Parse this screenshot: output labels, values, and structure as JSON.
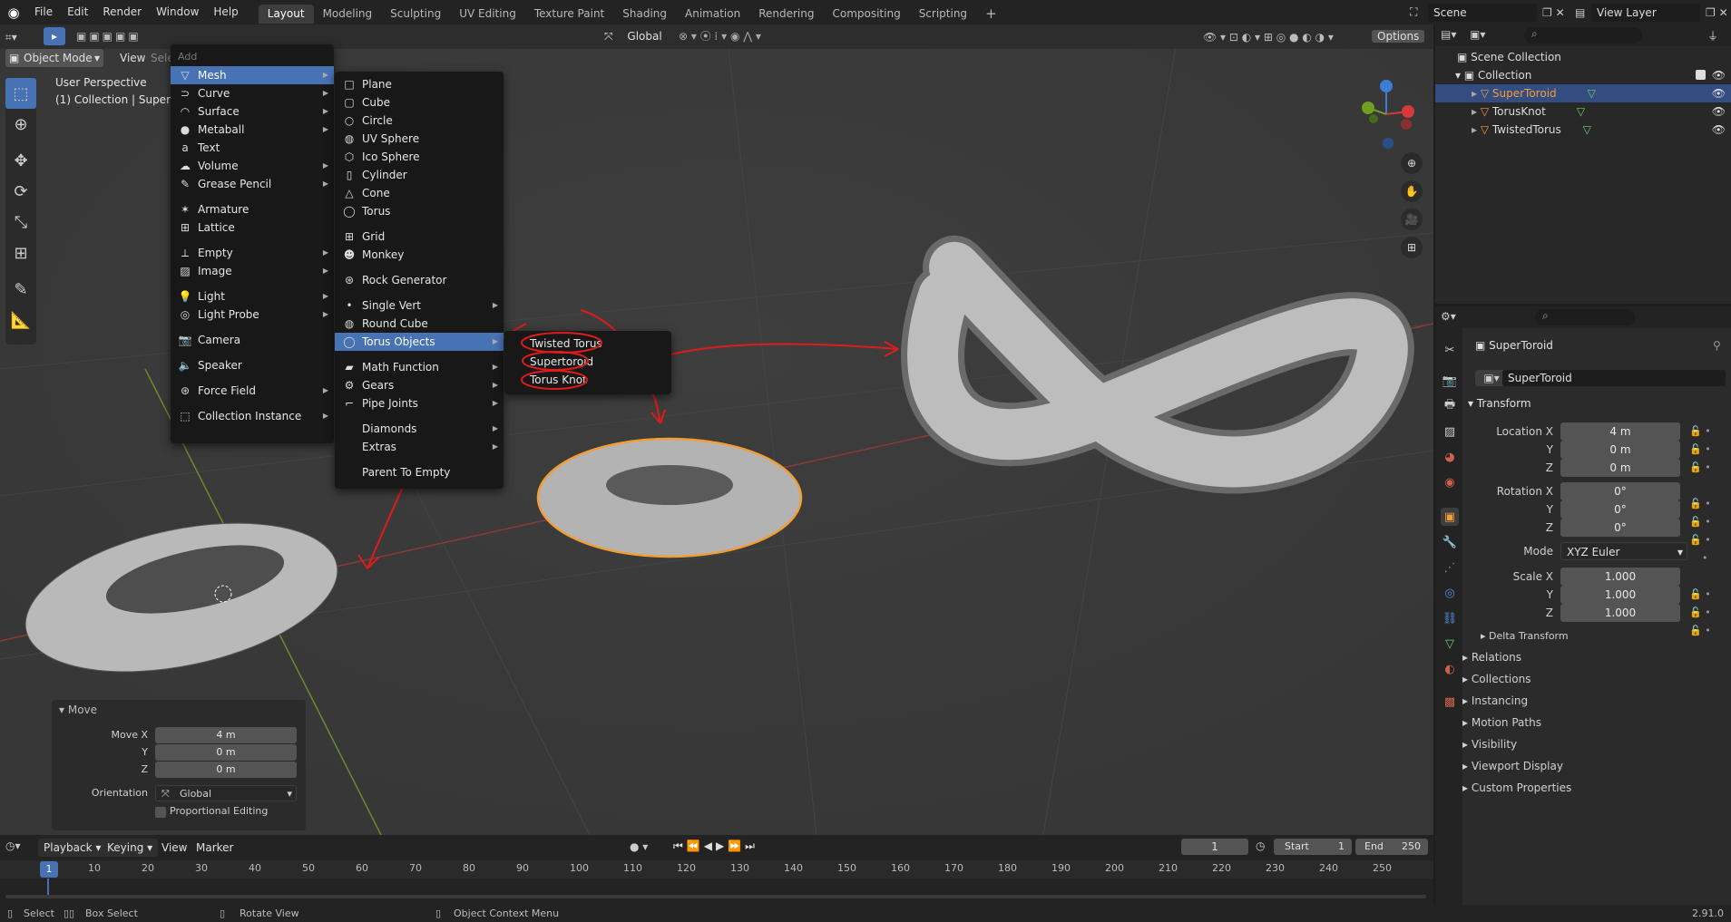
{
  "topbar": {
    "menus": [
      "File",
      "Edit",
      "Render",
      "Window",
      "Help"
    ],
    "workspaces": [
      "Layout",
      "Modeling",
      "Sculpting",
      "UV Editing",
      "Texture Paint",
      "Shading",
      "Animation",
      "Rendering",
      "Compositing",
      "Scripting"
    ],
    "scene": "Scene",
    "view_layer": "View Layer"
  },
  "viewport": {
    "mode": "Object Mode",
    "view": "View",
    "select": "Selec",
    "add": "Add",
    "orientation": "Global",
    "options": "Options",
    "perspective": "User Perspective",
    "collection_label": "(1) Collection | SuperToroid"
  },
  "add_menu": {
    "items": [
      "Mesh",
      "Curve",
      "Surface",
      "Metaball",
      "Text",
      "Volume",
      "Grease Pencil",
      "Armature",
      "Lattice",
      "Empty",
      "Image",
      "Light",
      "Light Probe",
      "Camera",
      "Speaker",
      "Force Field",
      "Collection Instance"
    ]
  },
  "mesh_menu": {
    "items": [
      "Plane",
      "Cube",
      "Circle",
      "UV Sphere",
      "Ico Sphere",
      "Cylinder",
      "Cone",
      "Torus",
      "Grid",
      "Monkey",
      "Rock Generator",
      "Single Vert",
      "Round Cube",
      "Torus Objects",
      "Math Function",
      "Gears",
      "Pipe Joints",
      "Diamonds",
      "Extras",
      "Parent To Empty"
    ]
  },
  "torus_menu": {
    "items": [
      "Twisted Torus",
      "Supertoroid",
      "Torus Knot"
    ]
  },
  "move_panel": {
    "title": "Move",
    "move_x_label": "Move X",
    "move_x": "4 m",
    "y_label": "Y",
    "y": "0 m",
    "z_label": "Z",
    "z": "0 m",
    "orientation_label": "Orientation",
    "orientation": "Global",
    "proportional": "Proportional Editing"
  },
  "outliner": {
    "scene_collection": "Scene Collection",
    "collection": "Collection",
    "objects": [
      "SuperToroid",
      "TorusKnot",
      "TwistedTorus"
    ]
  },
  "properties": {
    "object_name": "SuperToroid",
    "data_name": "SuperToroid",
    "transform": "Transform",
    "location_x_label": "Location X",
    "location_x": "4 m",
    "location_y": "0 m",
    "location_z": "0 m",
    "rotation_x_label": "Rotation X",
    "rotation_x": "0°",
    "rotation_y": "0°",
    "rotation_z": "0°",
    "mode_label": "Mode",
    "mode": "XYZ Euler",
    "scale_x_label": "Scale X",
    "scale_x": "1.000",
    "scale_y": "1.000",
    "scale_z": "1.000",
    "y_label": "Y",
    "z_label": "Z",
    "delta": "Delta Transform",
    "sections": [
      "Relations",
      "Collections",
      "Instancing",
      "Motion Paths",
      "Visibility",
      "Viewport Display",
      "Custom Properties"
    ]
  },
  "timeline": {
    "playback": "Playback",
    "keying": "Keying",
    "view": "View",
    "marker": "Marker",
    "current_frame": "1",
    "start_label": "Start",
    "start": "1",
    "end_label": "End",
    "end": "250",
    "ticks": [
      "1",
      "10",
      "20",
      "30",
      "40",
      "50",
      "60",
      "70",
      "80",
      "90",
      "100",
      "110",
      "120",
      "130",
      "140",
      "150",
      "160",
      "170",
      "180",
      "190",
      "200",
      "210",
      "220",
      "230",
      "240",
      "250"
    ]
  },
  "statusbar": {
    "select": "Select",
    "box_select": "Box Select",
    "rotate_view": "Rotate View",
    "context_menu": "Object Context Menu",
    "version": "2.91.0"
  },
  "colors": {
    "accent": "#4772b3",
    "selection": "#f29d37",
    "annotation": "#e01b1b"
  }
}
